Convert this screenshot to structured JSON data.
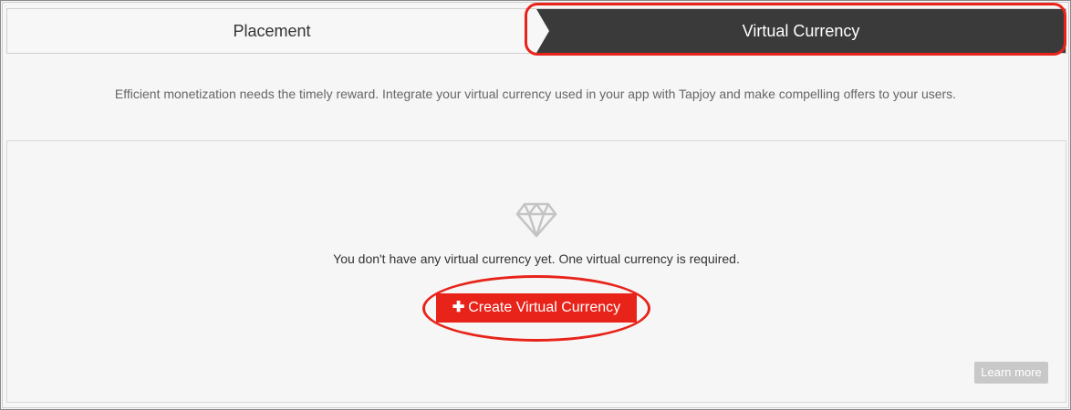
{
  "tabs": {
    "placement_label": "Placement",
    "virtual_currency_label": "Virtual Currency"
  },
  "intro_text": "Efficient monetization needs the timely reward. Integrate your virtual currency used in your app with Tapjoy and make compelling offers to your users.",
  "empty_state": {
    "icon": "diamond-icon",
    "message": "You don't have any virtual currency yet. One virtual currency is required.",
    "create_button_label": "Create Virtual Currency",
    "create_button_icon": "plus-icon",
    "learn_more_label": "Learn more"
  },
  "colors": {
    "accent": "#e8231a",
    "active_tab": "#3a3a3a",
    "learn_more_bg": "#c8c8c8"
  }
}
